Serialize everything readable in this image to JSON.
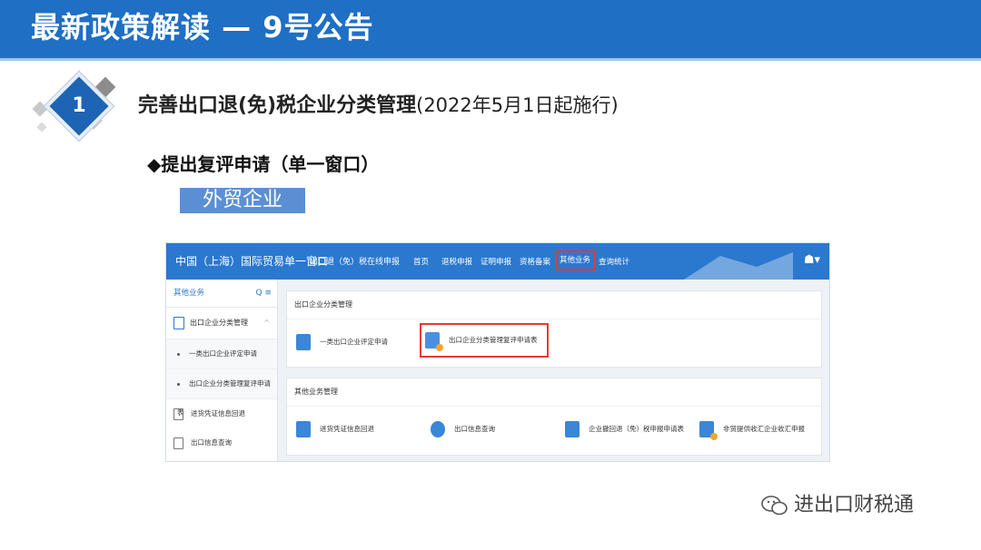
{
  "header": {
    "title": "最新政策解读 — 9号公告"
  },
  "section": {
    "number": "1",
    "heading": "完善出口退(免)税企业分类管理",
    "heading_note": "(2022年5月1日起施行)"
  },
  "subsection": {
    "label": "◆提出复评申请（单一窗口）"
  },
  "tag": {
    "label": "外贸企业"
  },
  "app": {
    "brand": "中国（上海）国际贸易单一窗口",
    "subtitle": "出口退（免）税在线申报",
    "nav": [
      "首页",
      "退税申报",
      "证明申报",
      "资格备案",
      "其他业务",
      "查询统计"
    ],
    "nav_highlight_index": 4,
    "user_icon": "☗",
    "sidebar": {
      "title": "其他业务",
      "tools": "Q ≡",
      "group": "出口企业分类管理",
      "group_items": [
        "一类出口企业评定申请",
        "出口企业分类管理复评申请表"
      ],
      "other_items": [
        "进货凭证信息回退",
        "出口信息查询"
      ]
    },
    "panel1": {
      "title": "出口企业分类管理",
      "tiles": [
        "一类出口企业评定申请",
        "出口企业分类管理复评申请表"
      ],
      "highlight_index": 1
    },
    "panel2": {
      "title": "其他业务管理",
      "tiles": [
        "进货凭证信息回退",
        "出口信息查询",
        "企业撤回退（免）税申报申请表",
        "非贸提供收汇企业收汇申报"
      ]
    }
  },
  "watermark": {
    "text": "进出口财税通"
  },
  "colors": {
    "header_blue": "#1f6fc5",
    "app_blue": "#2b78cf",
    "highlight_red": "#e53935",
    "tag_blue": "#5b8fd3"
  }
}
